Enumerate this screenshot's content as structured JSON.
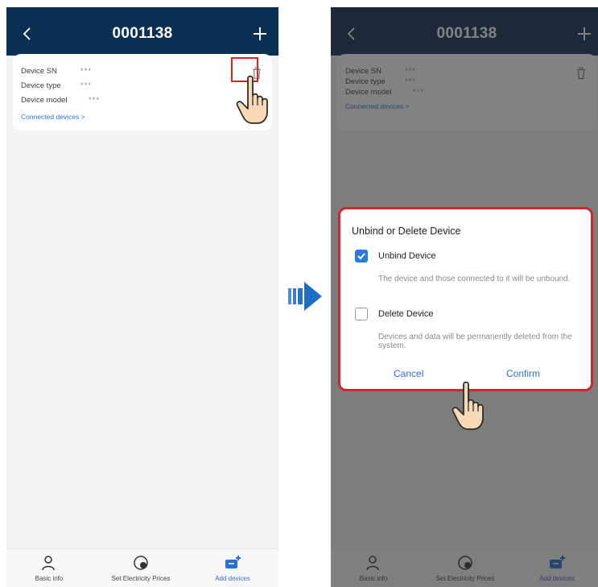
{
  "screens": {
    "left": {
      "title": "0001138",
      "card": {
        "rows": [
          {
            "label": "Device SN",
            "value": "***"
          },
          {
            "label": "Device type",
            "value": "***"
          },
          {
            "label": "Device model",
            "value": "***"
          }
        ],
        "link": "Connected devices >"
      },
      "nav": [
        {
          "label": "Basic info",
          "icon": "person-icon"
        },
        {
          "label": "Set Electricity Prices",
          "icon": "price-icon"
        },
        {
          "label": "Add devices",
          "icon": "add-device-icon",
          "active": true
        }
      ]
    },
    "right": {
      "title": "0001138",
      "card": {
        "rows": [
          {
            "label": "Device SN",
            "value": "***"
          },
          {
            "label": "Device type",
            "value": "***"
          },
          {
            "label": "Device model",
            "value": "***"
          }
        ],
        "link": "Connected devices >"
      },
      "nav": [
        {
          "label": "Basic info",
          "icon": "person-icon"
        },
        {
          "label": "Set Electricity Prices",
          "icon": "price-icon"
        },
        {
          "label": "Add devices",
          "icon": "add-device-icon",
          "active": true
        }
      ],
      "dialog": {
        "title": "Unbind or Delete Device",
        "options": [
          {
            "label": "Unbind Device",
            "checked": true,
            "description": "The device and those connected to it will be unbound."
          },
          {
            "label": "Delete Device",
            "checked": false,
            "description": "Devices and data will be permanently deleted from the system."
          }
        ],
        "cancel": "Cancel",
        "confirm": "Confirm"
      }
    }
  },
  "colors": {
    "header": "#0c2f54",
    "highlight": "#d9232a",
    "accent": "#2c78e4",
    "arrow": "#1f6fc0"
  }
}
